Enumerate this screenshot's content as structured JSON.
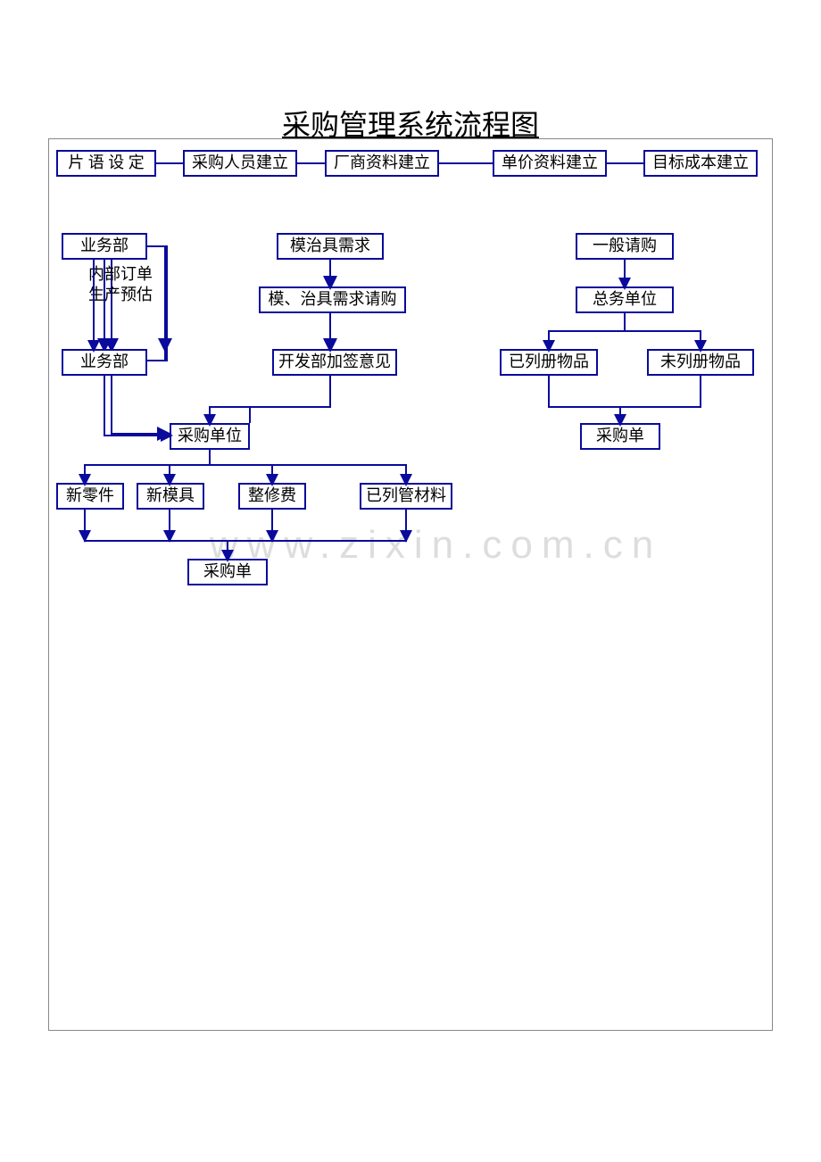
{
  "title": "采购管理系统流程图",
  "watermark": "www.zixin.com.cn",
  "row1": {
    "b1": "片 语 设 定",
    "b2": "采购人员建立",
    "b3": "厂商资料建立",
    "b4": "单价资料建立",
    "b5": "目标成本建立"
  },
  "left": {
    "biz1": "业务部",
    "internal": "内部订单\n生产预估",
    "biz2": "业务部"
  },
  "mid": {
    "mold_need": "模治具需求",
    "mold_req": "模、治具需求请购",
    "dev_sign": "开发部加签意见"
  },
  "right": {
    "general_req": "一般请购",
    "affairs": "总务单位",
    "listed": "已列册物品",
    "unlisted": "未列册物品",
    "po": "采购单"
  },
  "merge": {
    "purch_unit": "采购单位",
    "new_part": "新零件",
    "new_mold": "新模具",
    "repair": "整修费",
    "listed_mat": "已列管材料",
    "po": "采购单"
  }
}
